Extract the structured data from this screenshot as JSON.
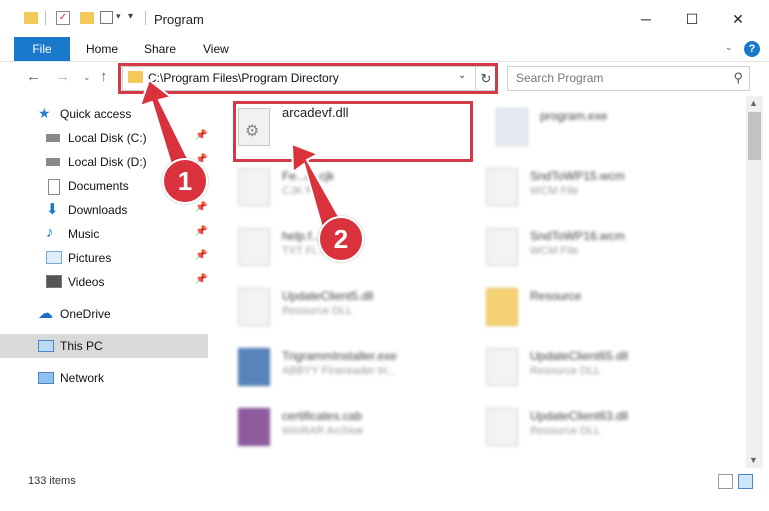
{
  "window": {
    "title": "Program",
    "controls": {
      "minimize": "─",
      "maximize": "☐",
      "close": "✕"
    }
  },
  "ribbon": {
    "file": "File",
    "tabs": [
      "Home",
      "Share",
      "View"
    ],
    "help": "?"
  },
  "address": {
    "path": "C:\\Program Files\\Program Directory",
    "search_placeholder": "Search Program"
  },
  "sidebar": {
    "quick_access": "Quick access",
    "items": [
      {
        "label": "Local Disk (C:)",
        "icon": "drive-icon",
        "pinned": true
      },
      {
        "label": "Local Disk (D:)",
        "icon": "drive-icon",
        "pinned": true
      },
      {
        "label": "Documents",
        "icon": "documents-icon",
        "pinned": true
      },
      {
        "label": "Downloads",
        "icon": "download-icon",
        "pinned": true
      },
      {
        "label": "Music",
        "icon": "music-icon",
        "pinned": true
      },
      {
        "label": "Pictures",
        "icon": "pictures-icon",
        "pinned": true
      },
      {
        "label": "Videos",
        "icon": "videos-icon",
        "pinned": true
      }
    ],
    "onedrive": "OneDrive",
    "this_pc": "This PC",
    "network": "Network"
  },
  "files": [
    {
      "name": "arcadevf.dll",
      "type": ""
    },
    {
      "name": "program.exe",
      "type": ""
    },
    {
      "name": "Fe...m.cjk",
      "type": "CJK Fi..."
    },
    {
      "name": "SndToWP15.wcm",
      "type": "WCM File"
    },
    {
      "name": "help.f...der.txt",
      "type": "TXT Fi..."
    },
    {
      "name": "SndToWP16.wcm",
      "type": "WCM File"
    },
    {
      "name": "UpdateClient5.dll",
      "type": "Resource DLL"
    },
    {
      "name": "Resource",
      "type": ""
    },
    {
      "name": "TrigrammInstaller.exe",
      "type": "ABBYY Finereader tri..."
    },
    {
      "name": "UpdateClient65.dll",
      "type": "Resource DLL"
    },
    {
      "name": "certificates.cab",
      "type": "WinRAR Archive"
    },
    {
      "name": "UpdateClient63.dll",
      "type": "Resource DLL"
    }
  ],
  "status": {
    "count": "133 items"
  },
  "annotations": {
    "step1": "1",
    "step2": "2"
  },
  "colors": {
    "accent": "#1979ca",
    "annotation_red": "#d33a45"
  }
}
